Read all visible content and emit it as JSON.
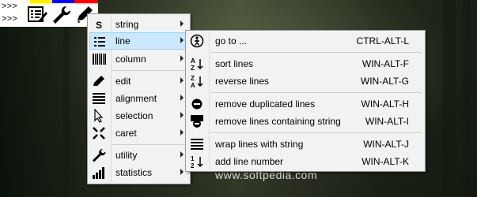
{
  "toolbar": {
    "arrows": [
      ">>>",
      ">>>"
    ],
    "icons": [
      "list-edit-icon",
      "wrench-icon",
      "pencil-icon"
    ],
    "color_bar": [
      "#ffee00",
      "#0000ff",
      "#ff0000"
    ]
  },
  "main_menu": {
    "items": [
      {
        "icon": "letter-s-icon",
        "label": "string",
        "submenu": true
      },
      {
        "icon": "list-icon",
        "label": "line",
        "submenu": true,
        "highlighted": true
      },
      {
        "icon": "barcode-icon",
        "label": "column",
        "submenu": true
      },
      {
        "icon": "pencil-icon",
        "label": "edit",
        "submenu": true
      },
      {
        "icon": "align-icon",
        "label": "alignment",
        "submenu": true
      },
      {
        "icon": "cursor-icon",
        "label": "selection",
        "submenu": true
      },
      {
        "icon": "caret-icon",
        "label": "caret",
        "submenu": true
      },
      {
        "icon": "wrench-icon",
        "label": "utility",
        "submenu": true
      },
      {
        "icon": "bar-chart-icon",
        "label": "statistics",
        "submenu": true
      }
    ]
  },
  "line_menu": {
    "items": [
      {
        "icon": "goto-icon",
        "label": "go to ...",
        "shortcut": "CTRL-ALT-L"
      },
      {
        "icon": "sort-az-icon",
        "label": "sort lines",
        "shortcut": "WIN-ALT-F"
      },
      {
        "icon": "sort-za-icon",
        "label": "reverse lines",
        "shortcut": "WIN-ALT-G"
      },
      {
        "icon": "remove-duplicates-icon",
        "label": "remove duplicated lines",
        "shortcut": "WIN-ALT-H"
      },
      {
        "icon": "remove-string-icon",
        "label": "remove lines containing string",
        "shortcut": "WIN-ALT-I"
      },
      {
        "icon": "wrap-lines-icon",
        "label": "wrap lines with string",
        "shortcut": "WIN-ALT-J"
      },
      {
        "icon": "line-number-icon",
        "label": "add line number",
        "shortcut": "WIN-ALT-K"
      }
    ]
  },
  "watermark": "www.softpedia.com"
}
